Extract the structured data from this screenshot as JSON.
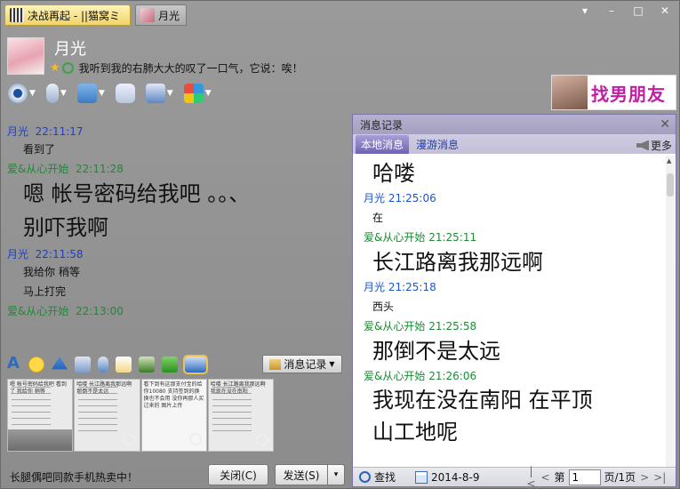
{
  "tabs": [
    {
      "label": "决战再起 - ||猫窝ミ"
    },
    {
      "label": "月光"
    }
  ],
  "window_controls": {
    "menu": "▾",
    "minimize": "–",
    "maximize": "□",
    "close": "✕"
  },
  "contact": {
    "name": "月光",
    "signature": "我听到我的右肺大大的叹了一口气，它说：唉！"
  },
  "ad": {
    "text": "找男朋友"
  },
  "chat": [
    {
      "sender": "月光",
      "time": "22:11:17",
      "color": "blue",
      "lines": [
        {
          "text": "看到了",
          "big": false
        }
      ]
    },
    {
      "sender": "爱&从心开始",
      "time": "22:11:28",
      "color": "green",
      "lines": [
        {
          "text": "嗯 帐号密码给我吧 。。、",
          "big": true
        },
        {
          "text": "别吓我啊",
          "big": true
        }
      ]
    },
    {
      "sender": "月光",
      "time": "22:11:58",
      "color": "blue",
      "lines": [
        {
          "text": "我给你 稍等",
          "big": false
        },
        {
          "text": "马上打完",
          "big": false
        }
      ]
    },
    {
      "sender": "爱&从心开始",
      "time": "22:13:00",
      "color": "green",
      "lines": []
    }
  ],
  "edit_toolbar": {
    "font_label": "A",
    "history_button": "消息记录"
  },
  "thumbnails": [
    {
      "text": "嗯 帐号密码给我吧 看到了 我给你 稍等"
    },
    {
      "text": "哈喽 长江路离我那远啊 那倒不是太远"
    },
    {
      "text": "看下到有这那支付宝的给你10080 支持签到的换换也不会用 没你再那人买过来的 图片上传"
    },
    {
      "text": "哈喽 长江路离我那远啊 我现在没在南阳"
    }
  ],
  "footer": {
    "promo": "长腿偶吧同款手机热卖中！",
    "close_button": "关闭(C)",
    "send_button": "发送(S)",
    "send_dropdown": "▾"
  },
  "history": {
    "title": "消息记录",
    "close": "✕",
    "tabs": [
      {
        "label": "本地消息",
        "active": true
      },
      {
        "label": "漫游消息",
        "active": false
      }
    ],
    "more_label": "更多",
    "entries": [
      {
        "kind": "text",
        "text": "哈喽",
        "big": true
      },
      {
        "kind": "head",
        "sender": "月光",
        "time": "21:25:06",
        "color": "blue"
      },
      {
        "kind": "text",
        "text": "在",
        "big": false
      },
      {
        "kind": "head",
        "sender": "爱&从心开始",
        "time": "21:25:11",
        "color": "green"
      },
      {
        "kind": "text",
        "text": "长江路离我那远啊",
        "big": true
      },
      {
        "kind": "head",
        "sender": "月光",
        "time": "21:25:18",
        "color": "blue"
      },
      {
        "kind": "text",
        "text": "西头",
        "big": false
      },
      {
        "kind": "head",
        "sender": "爱&从心开始",
        "time": "21:25:58",
        "color": "green"
      },
      {
        "kind": "text",
        "text": "那倒不是太远",
        "big": true
      },
      {
        "kind": "head",
        "sender": "爱&从心开始",
        "time": "21:26:06",
        "color": "green"
      },
      {
        "kind": "text",
        "text": "我现在没在南阳 在平顶",
        "big": true
      },
      {
        "kind": "text",
        "text": "山工地呢",
        "big": true
      }
    ],
    "footer": {
      "search_label": "查找",
      "date": "2014-8-9",
      "page_prefix": "第",
      "page_value": "1",
      "page_suffix": "页/1页"
    }
  },
  "colors": {
    "blue_sender": "#1a3fd0",
    "green_sender": "#1d8a34",
    "ad_text": "#c01fa4"
  }
}
